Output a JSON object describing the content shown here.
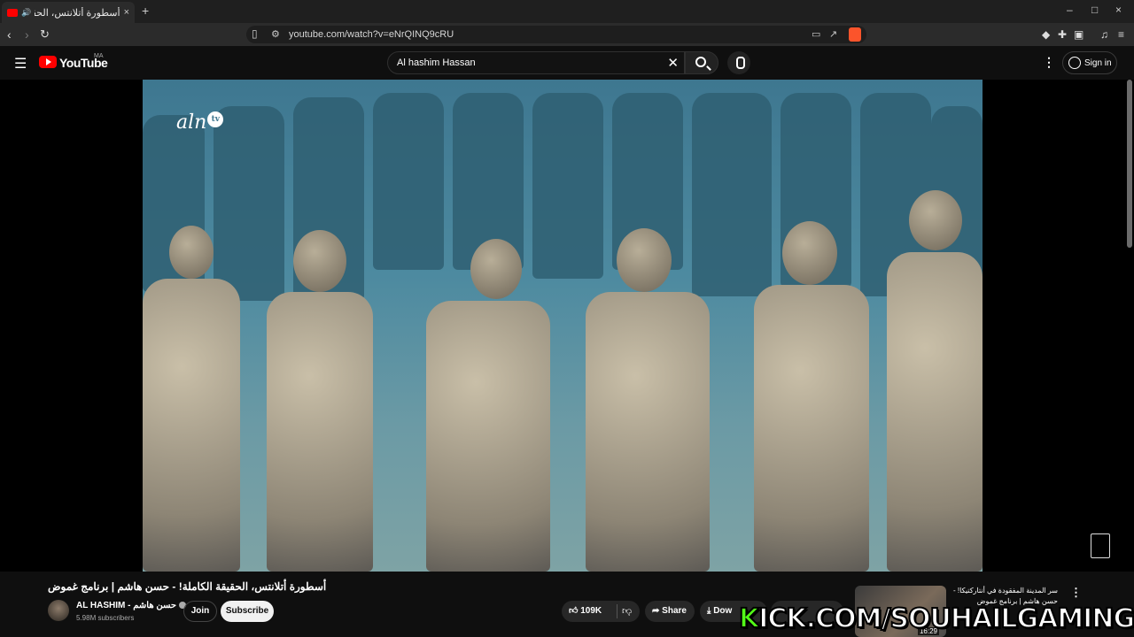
{
  "browser": {
    "tab_title": "أسطورة أتلانتس، الحقيقة الكاملة",
    "url": "youtube.com/watch?v=eNrQINQ9cRU",
    "new_tab": "+",
    "close_tab": "×",
    "minimize": "–",
    "maximize": "□",
    "close_window": "×"
  },
  "header": {
    "logo_text": "YouTube",
    "country_code": "MA",
    "search_query": "Al hashim Hassan",
    "sign_in": "Sign in"
  },
  "video": {
    "watermark": "aln",
    "watermark_badge": "tv"
  },
  "info": {
    "title": "أسطورة أتلانتس، الحقيقة الكاملة! - حسن هاشم | برنامج غموض",
    "channel_name": "AL HASHIM - حسن هاشم",
    "subscribers": "5.98M subscribers",
    "join": "Join",
    "subscribe": "Subscribe",
    "likes": "109K",
    "share": "Share",
    "download": "Dow"
  },
  "related": {
    "title": "سر المدينة المفقودة في أنتاركتيكا! - حسن هاشم | برنامج غموض",
    "duration": "16:29"
  },
  "overlay": {
    "kick_k": "K",
    "kick_rest": "ICK.COM/SOUHAILGAMING"
  },
  "colors": {
    "brand_red": "#ff0000",
    "kick_green": "#53fc18",
    "background": "#0f0f0f"
  }
}
